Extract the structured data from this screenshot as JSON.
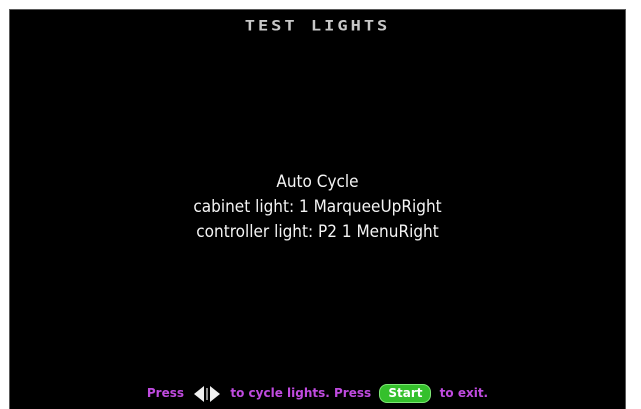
{
  "screen": {
    "title": "TEST LIGHTS",
    "mode": "Auto Cycle",
    "cabinet_light": "cabinet light: 1 MarqueeUpRight",
    "controller_light": "controller light: P2 1 MenuRight"
  },
  "footer": {
    "prefix": "Press",
    "cycle_text": "to cycle lights.",
    "press_again": "Press",
    "start_label": "Start",
    "exit_text": "to exit."
  },
  "icons": {
    "left_arrow": "left-arrow-icon",
    "right_arrow": "right-arrow-icon"
  },
  "colors": {
    "background": "#000000",
    "title": "#c8c8c8",
    "text": "#f4f4f4",
    "footer_text": "#c04be0",
    "start_button": "#35c02c",
    "arrow": "#f0f0f0"
  }
}
